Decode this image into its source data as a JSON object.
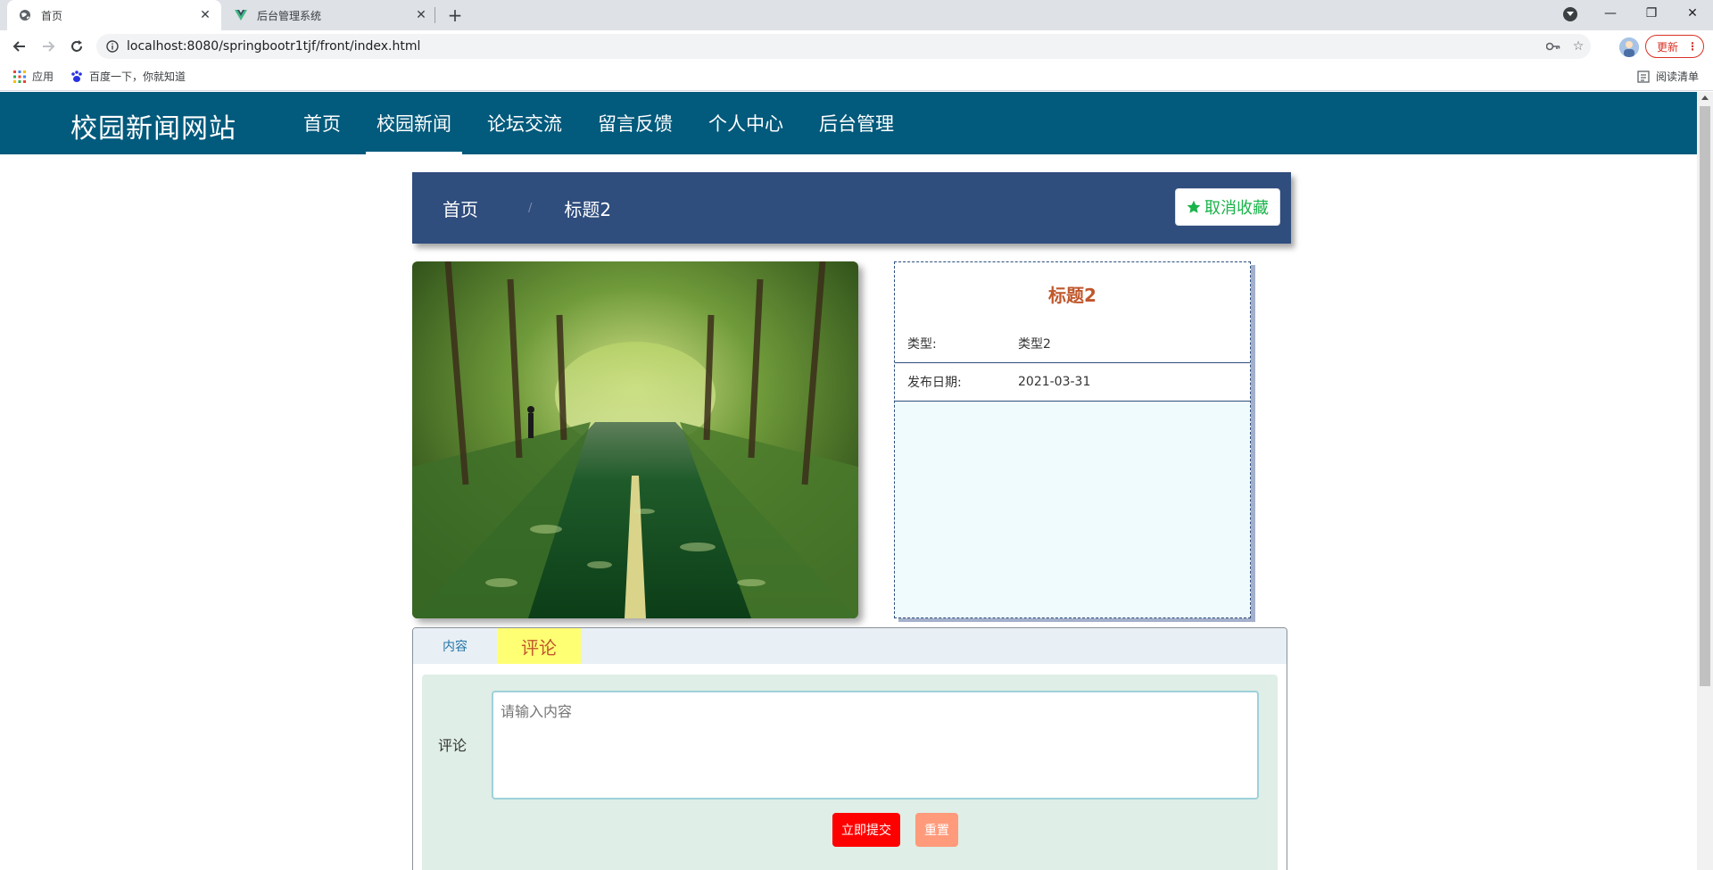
{
  "browser": {
    "tabs": [
      {
        "title": "首页",
        "icon": "globe-icon",
        "active": true
      },
      {
        "title": "后台管理系统",
        "icon": "vue-icon",
        "active": false
      }
    ],
    "url": "localhost:8080/springbootr1tjf/front/index.html",
    "update_label": "更新",
    "bookmarks": [
      {
        "label": "应用",
        "icon": "apps-grid-icon"
      },
      {
        "label": "百度一下，你就知道",
        "icon": "baidu-paw-icon"
      }
    ],
    "reading_list_label": "阅读清单"
  },
  "site": {
    "logo": "校园新闻网站",
    "nav": [
      {
        "label": "首页",
        "active": false
      },
      {
        "label": "校园新闻",
        "active": true
      },
      {
        "label": "论坛交流",
        "active": false
      },
      {
        "label": "留言反馈",
        "active": false
      },
      {
        "label": "个人中心",
        "active": false
      },
      {
        "label": "后台管理",
        "active": false
      }
    ],
    "header_color": "#025a7c"
  },
  "breadcrumb": {
    "home": "首页",
    "separator": "/",
    "current": "标题2",
    "favorite_label": "取消收藏"
  },
  "detail": {
    "title": "标题2",
    "rows": [
      {
        "label": "类型:",
        "value": "类型2"
      },
      {
        "label": "发布日期:",
        "value": "2021-03-31"
      }
    ]
  },
  "tabs": {
    "content_label": "内容",
    "comment_label": "评论",
    "active": "comment"
  },
  "comment_form": {
    "label": "评论",
    "placeholder": "请输入内容",
    "value": "",
    "submit_label": "立即提交",
    "reset_label": "重置"
  },
  "colors": {
    "accent": "#2f4d7d",
    "title": "#c0572c",
    "submit": "#ff0000",
    "reset": "#ff9a7a",
    "favorite": "#19b34a"
  }
}
